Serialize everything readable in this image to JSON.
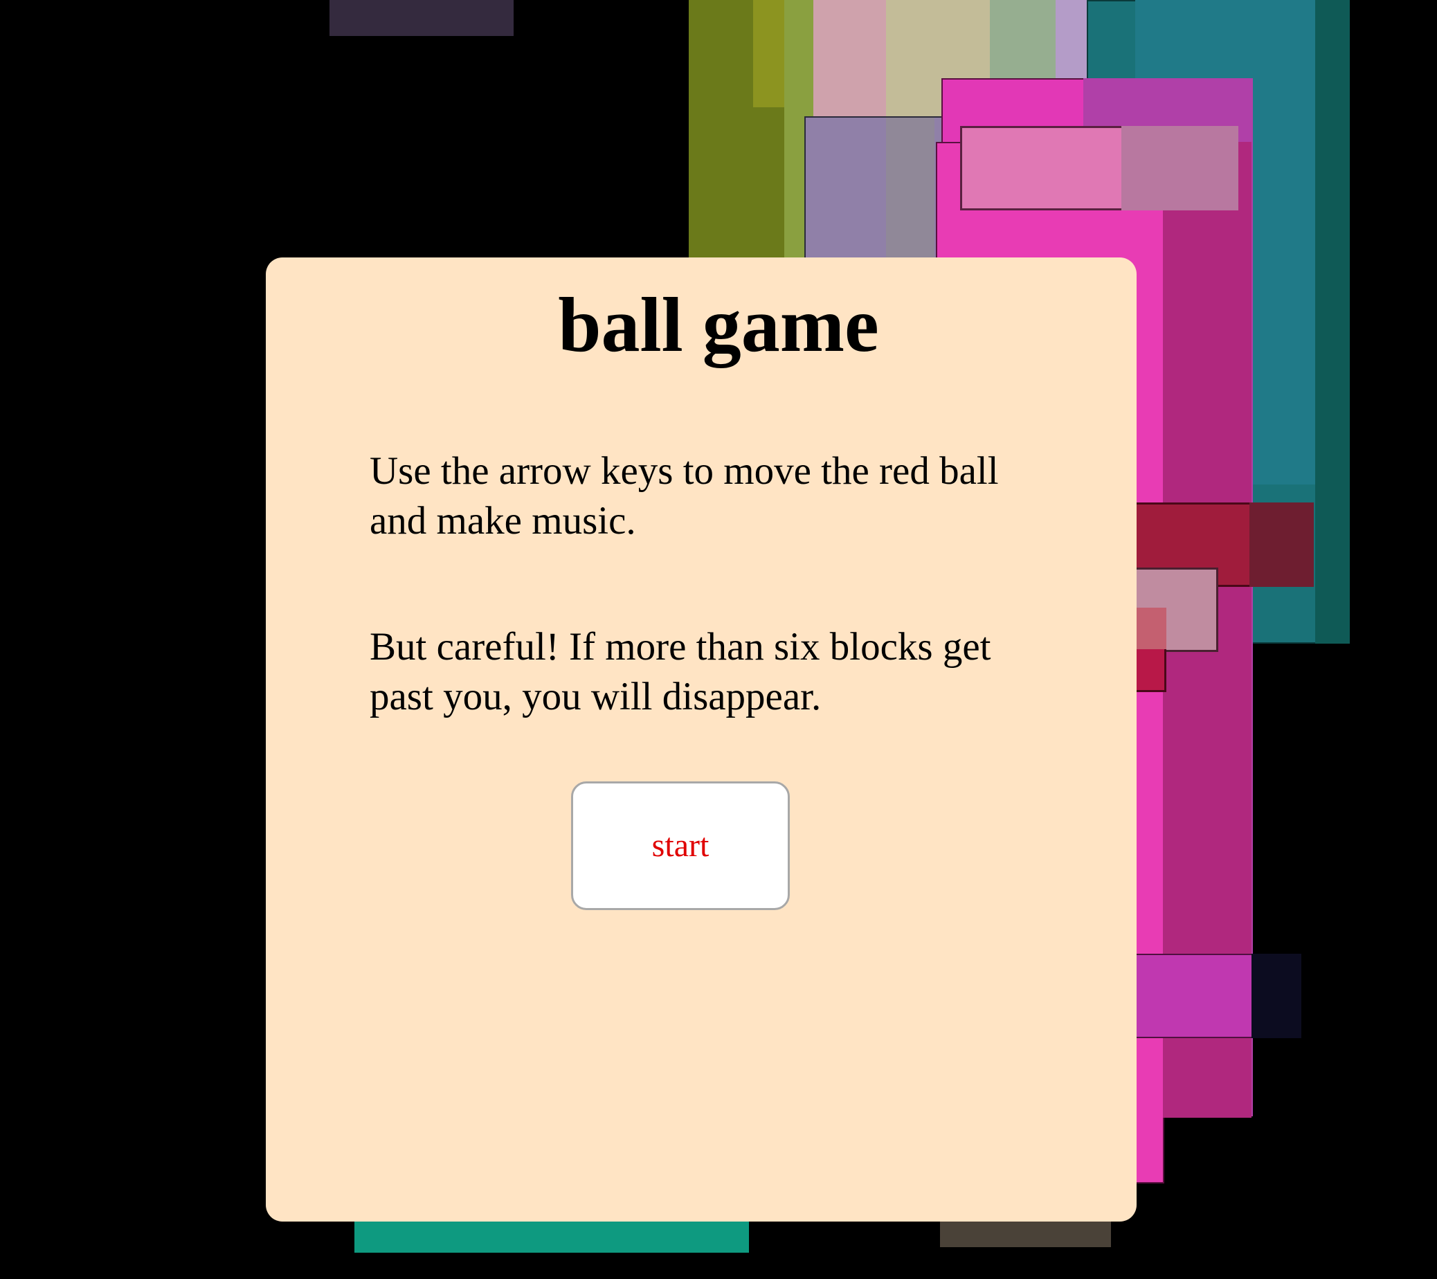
{
  "dialog": {
    "title": "ball game",
    "instruction_1": "Use the arrow keys to move the red ball and make music.",
    "instruction_2": "But careful! If more than six blocks get past you, you will disappear.",
    "start_label": "start"
  },
  "colors": {
    "background": "#000000",
    "dialog_background": "#ffe4c4",
    "start_text": "#e00000",
    "start_border": "#a8a8a8"
  }
}
